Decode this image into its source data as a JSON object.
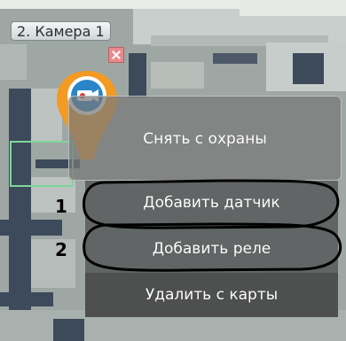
{
  "camera_chip": {
    "label": "2. Камера 1"
  },
  "context_menu": {
    "items": [
      {
        "label": "Снять с охраны"
      },
      {
        "label": "Добавить датчик"
      },
      {
        "label": "Добавить реле"
      },
      {
        "label": "Удалить с карты"
      }
    ]
  },
  "callouts": [
    {
      "number": "1"
    },
    {
      "number": "2"
    }
  ],
  "icons": {
    "camera_pin": "camera-pin-icon",
    "close": "close-icon"
  },
  "colors": {
    "pin_orange": "#f29a22",
    "pin_blue": "#2a86c9",
    "menu_gray": "#5a5c5c",
    "callout_outline": "#000000"
  }
}
